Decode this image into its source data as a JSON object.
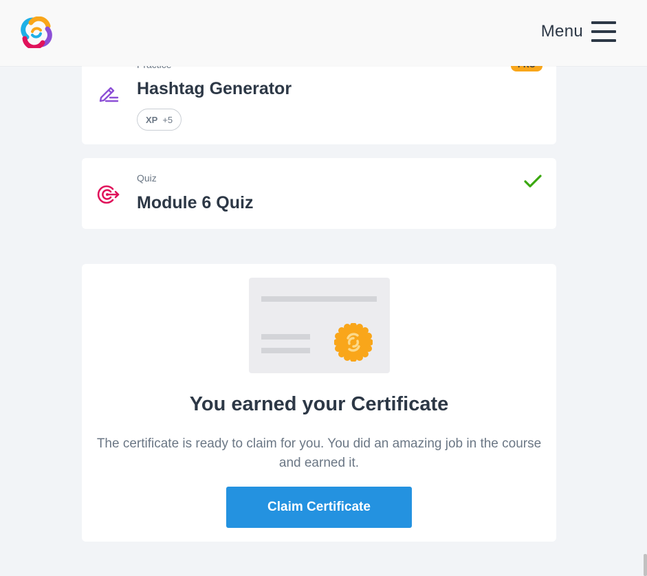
{
  "header": {
    "logo_icon": "sololearn-logo-icon",
    "menu_label": "Menu",
    "menu_icon": "hamburger-icon"
  },
  "practice_item": {
    "type_label": "Practice",
    "title": "Hashtag Generator",
    "icon": "pencil-edit-icon",
    "xp_label": "XP",
    "xp_value": "+5",
    "pro_badge": "PRO"
  },
  "quiz_item": {
    "type_label": "Quiz",
    "title": "Module 6 Quiz",
    "icon": "target-icon",
    "status_icon": "checkmark-icon"
  },
  "certificate": {
    "heading": "You earned your Certificate",
    "description": "The certificate is ready to claim for you. You did an amazing job in the course and earned it.",
    "button_label": "Claim Certificate",
    "seal_icon": "certificate-seal-icon"
  },
  "colors": {
    "accent_blue": "#2492e0",
    "pro_orange": "#f9a61a",
    "check_green": "#3aa80f",
    "practice_purple": "#8c4fd6",
    "quiz_pink": "#e0135b",
    "text_dark": "#2d3846",
    "text_muted": "#6b7785",
    "page_bg": "#f2f4f7"
  }
}
